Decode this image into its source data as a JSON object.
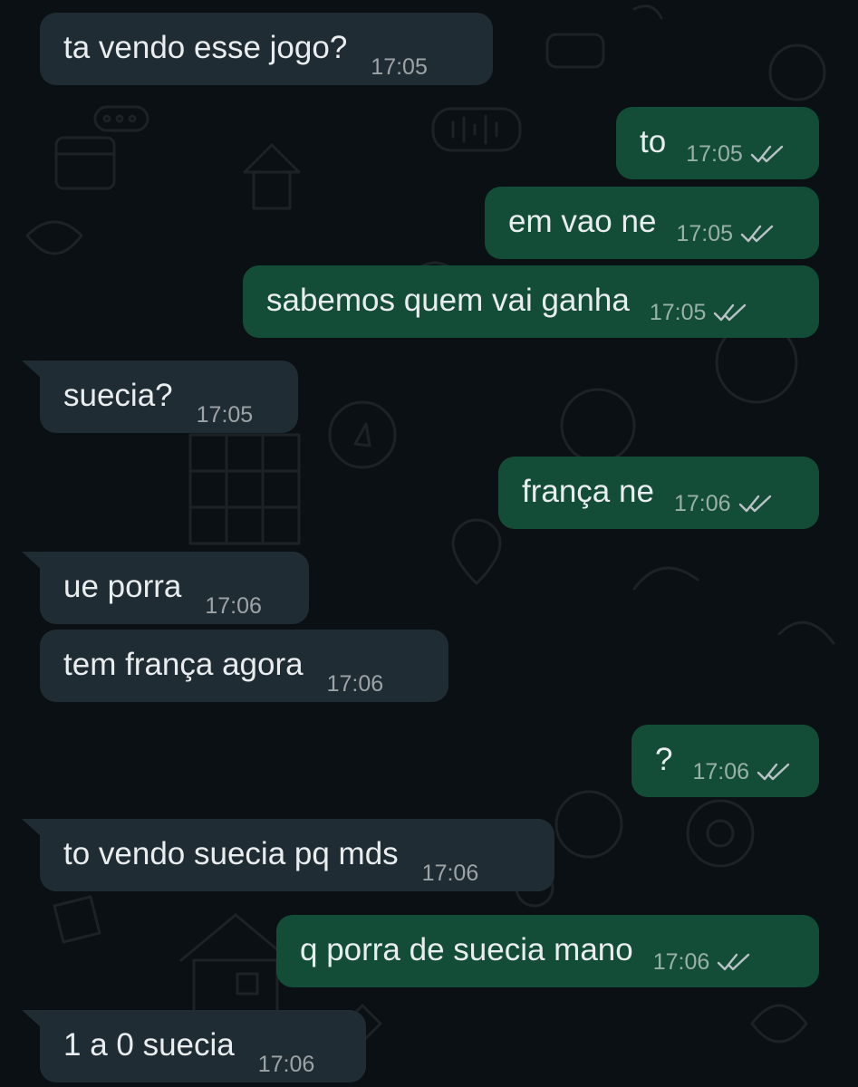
{
  "colors": {
    "background": "#0b1014",
    "incoming_bubble": "#202c33",
    "outgoing_bubble": "#144d37",
    "text": "#e9edef",
    "ticks": "#b9c2c6"
  },
  "messages": [
    {
      "direction": "in",
      "text": "ta vendo esse jogo?",
      "time": "17:05"
    },
    {
      "direction": "out",
      "text": "to",
      "time": "17:05",
      "status": "delivered-double-check"
    },
    {
      "direction": "out",
      "text": "em vao ne",
      "time": "17:05",
      "status": "delivered-double-check"
    },
    {
      "direction": "out",
      "text": "sabemos quem vai ganha",
      "time": "17:05",
      "status": "delivered-double-check"
    },
    {
      "direction": "in",
      "text": "suecia?",
      "time": "17:05"
    },
    {
      "direction": "out",
      "text": "frança ne",
      "time": "17:06",
      "status": "delivered-double-check"
    },
    {
      "direction": "in",
      "text": "ue porra",
      "time": "17:06"
    },
    {
      "direction": "in",
      "text": "tem frança agora",
      "time": "17:06"
    },
    {
      "direction": "out",
      "text": "?",
      "time": "17:06",
      "status": "delivered-double-check"
    },
    {
      "direction": "in",
      "text": "to vendo suecia pq mds",
      "time": "17:06"
    },
    {
      "direction": "out",
      "text": "q porra de suecia mano",
      "time": "17:06",
      "status": "delivered-double-check"
    },
    {
      "direction": "in",
      "text": "1 a 0 suecia",
      "time": "17:06"
    }
  ]
}
